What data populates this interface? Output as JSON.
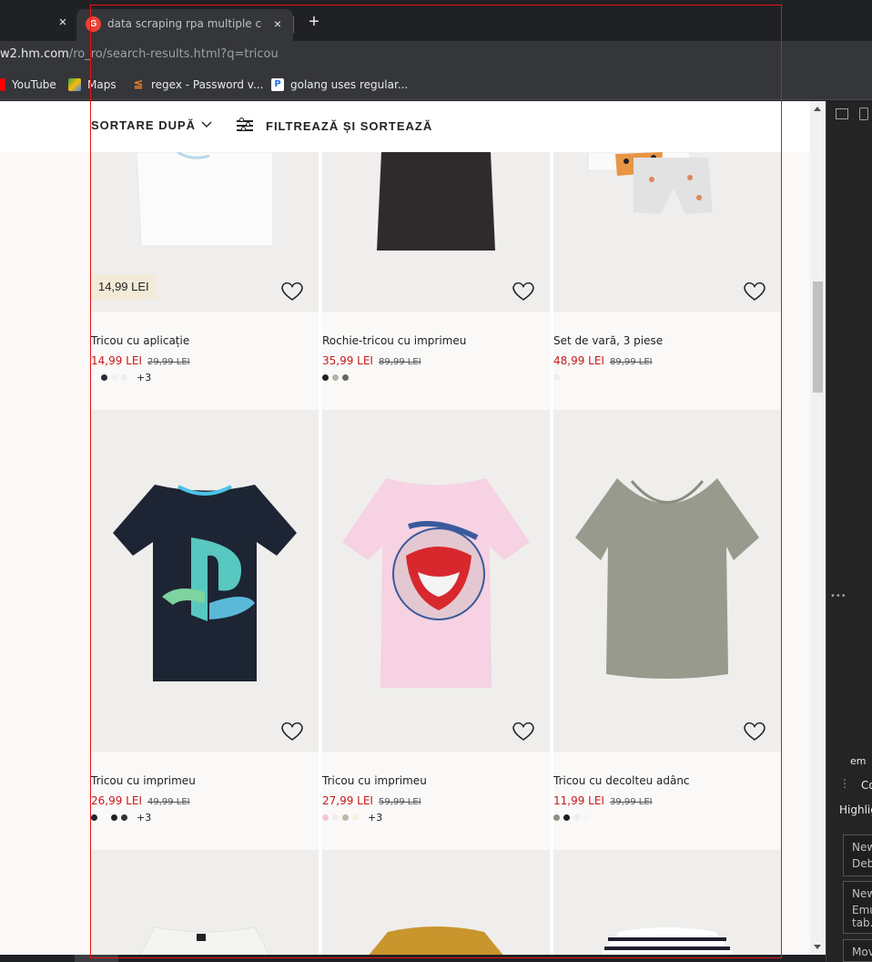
{
  "browser": {
    "left_tab_close": "×",
    "active_tab": {
      "title": "data scraping rpa multiple colum",
      "close": "×"
    },
    "new_tab": "+",
    "url": {
      "host": "w2.hm.com",
      "path": "/ro_ro/search-results.html?q=tricou"
    },
    "bookmarks": [
      {
        "label": "YouTube",
        "icon": "youtube-icon",
        "color": "#ff0000"
      },
      {
        "label": "Maps",
        "icon": "maps-icon",
        "color": "#34a853"
      },
      {
        "label": "regex - Password v...",
        "icon": "stackoverflow-icon",
        "color": "#f48024"
      },
      {
        "label": "golang uses regular...",
        "icon": "bookmark-p-icon",
        "color": "#1a73e8"
      }
    ]
  },
  "toolbar": {
    "sort_label": "SORTARE DUPĂ",
    "filter_label": "FILTREAZĂ ȘI SORTEAZĂ"
  },
  "products": [
    {
      "name": "Tricou cu aplicație",
      "price": "14,99 LEI",
      "old_price": "29,99 LEI",
      "badge": "14,99 LEI",
      "swatches": [
        "#ffffff",
        "#2b2b3a",
        "#f1f1f1",
        "#eeeeee"
      ],
      "more": "+3"
    },
    {
      "name": "Rochie-tricou cu imprimeu",
      "price": "35,99 LEI",
      "old_price": "89,99 LEI",
      "swatches": [
        "#222222",
        "#b8b1a6",
        "#666666"
      ],
      "more": ""
    },
    {
      "name": "Set de vară, 3 piese",
      "price": "48,99 LEI",
      "old_price": "89,99 LEI",
      "swatches": [
        "#eeeeee"
      ],
      "more": ""
    },
    {
      "name": "Tricou cu imprimeu",
      "price": "26,99 LEI",
      "old_price": "49,99 LEI",
      "swatches": [
        "#1d2434",
        "#faf9f8",
        "#222222",
        "#333333"
      ],
      "more": "+3"
    },
    {
      "name": "Tricou cu imprimeu",
      "price": "27,99 LEI",
      "old_price": "59,99 LEI",
      "swatches": [
        "#f4c6d8",
        "#eeeeee",
        "#bdb7a6",
        "#f5f0e0"
      ],
      "more": "+3"
    },
    {
      "name": "Tricou cu decolteu adânc",
      "price": "11,99 LEI",
      "old_price": "39,99 LEI",
      "swatches": [
        "#8e9284",
        "#1c1c1c",
        "#eeeeee",
        "#f5f5f5"
      ],
      "more": ""
    }
  ],
  "devtools": {
    "label_em": "em",
    "label_co": "Co",
    "highlight": "Highlig",
    "box1_line1": "New",
    "box1_line2": "Deb",
    "box2_line1": "New",
    "box2_line2": "Emu",
    "box2_line3": "tab.",
    "box3_line1": "Mov"
  }
}
